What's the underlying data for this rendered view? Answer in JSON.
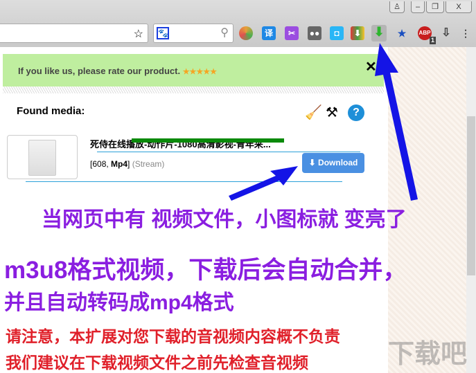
{
  "browser": {
    "profile_icon": "user-icon",
    "minimize": "–",
    "restore": "❐",
    "close": "X",
    "bookmark_icon": "star-icon",
    "search_icon": "magnifier-icon",
    "toolbar_icons": [
      "chrome-icon",
      "translate-icon",
      "scissors-icon",
      "ghost-icon",
      "camera-icon",
      "shield-download-icon",
      "video-downloader-icon",
      "bookmark-star-icon",
      "adblock-icon",
      "downloads-icon",
      "menu-icon"
    ],
    "translate_label": "译",
    "adblock_label": "ABP",
    "adblock_count": "1"
  },
  "popup": {
    "rate_text": "If you like us, please rate our product.",
    "stars": "★★★★★",
    "close": "✕",
    "found_label": "Found media:",
    "media": {
      "title": "死侍在线播放-动作片-1080高清影视-青年采...",
      "size": "608",
      "format": "Mp4",
      "type": "(Stream)",
      "download": "Download"
    }
  },
  "captions": {
    "line1": "当网页中有 视频文件，小图标就 变亮了",
    "line2": "m3u8格式视频，下载后会自动合并，",
    "line3": "并且自动转码成mp4格式",
    "line4": "请注意，本扩展对您下载的音视频内容概不负责",
    "line5": "我们建议在下载视频文件之前先检查音视频"
  },
  "watermark": "下载吧",
  "colors": {
    "caption_purple": "#8a1ee0",
    "caption_red": "#e0202a",
    "arrow": "#1414e6",
    "accent": "#4a90e2"
  }
}
